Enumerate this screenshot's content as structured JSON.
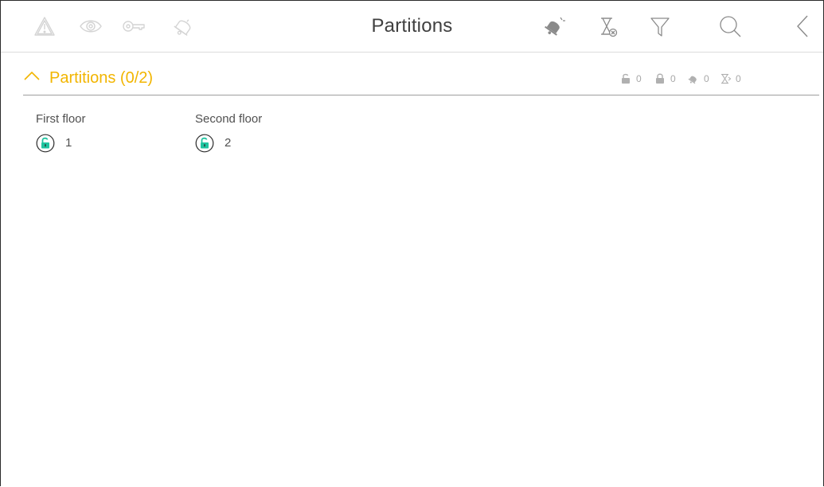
{
  "header": {
    "title": "Partitions",
    "left_icons": [
      "alarm-triangle-icon",
      "eye-icon",
      "key-icon",
      "bell-icon"
    ],
    "right_icons": [
      "alarm-bell-icon",
      "hourglass-cancel-icon",
      "filter-icon",
      "search-icon",
      "back-chevron-icon"
    ],
    "disabled_icon_color": "#d4d4d4",
    "active_icon_color": "#8a8a8a"
  },
  "section": {
    "title": "Partitions (0/2)",
    "accent_color": "#f2b500",
    "counters": [
      {
        "icon": "unlocked-icon",
        "value": "0"
      },
      {
        "icon": "locked-icon",
        "value": "0"
      },
      {
        "icon": "alarm-bell-icon",
        "value": "0"
      },
      {
        "icon": "hourglass-icon",
        "value": "0"
      }
    ]
  },
  "partitions": [
    {
      "name": "First floor",
      "number": "1",
      "status": "unlocked",
      "status_color": "#1fc4a0"
    },
    {
      "name": "Second floor",
      "number": "2",
      "status": "unlocked",
      "status_color": "#1fc4a0"
    }
  ]
}
